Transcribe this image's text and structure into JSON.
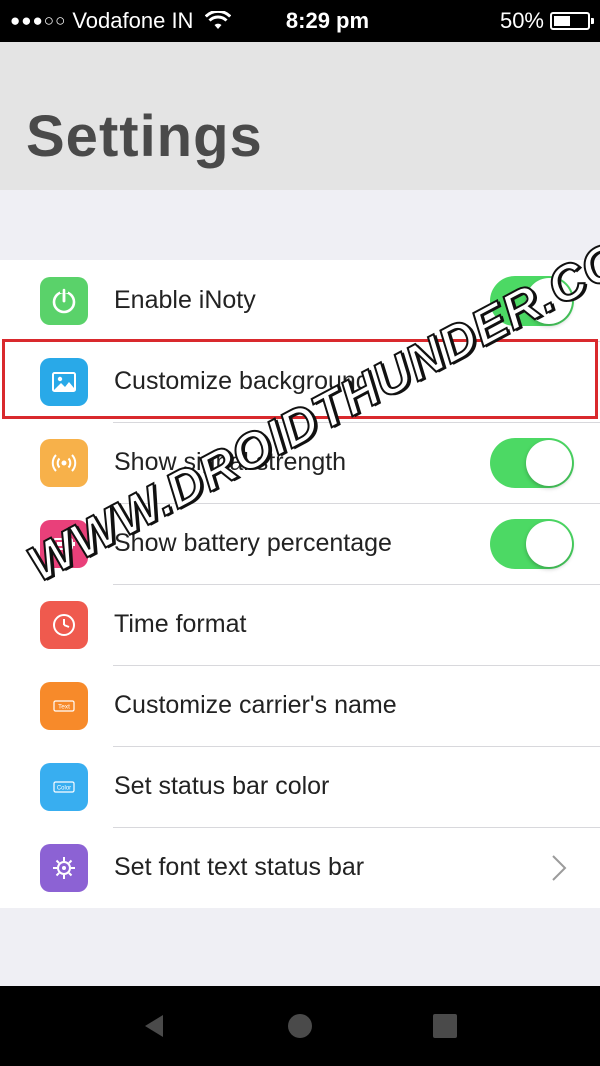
{
  "status_bar": {
    "carrier": "Vodafone IN",
    "time": "8:29 pm",
    "battery": "50%",
    "battery_level": 0.5,
    "signal_dots": "●●●○○"
  },
  "header": {
    "title": "Settings"
  },
  "settings": [
    {
      "label": "Enable iNoty",
      "icon": "power-icon",
      "color": "#5ad26a",
      "control": "toggle",
      "on": true
    },
    {
      "label": "Customize background",
      "icon": "image-icon",
      "color": "#29a9e8",
      "control": "none"
    },
    {
      "label": "Show signal strength",
      "icon": "signal-icon",
      "color": "#f7b14a",
      "control": "toggle",
      "on": true
    },
    {
      "label": "Show battery percentage",
      "icon": "battery-icon",
      "color": "#e9407a",
      "control": "toggle",
      "on": true
    },
    {
      "label": "Time format",
      "icon": "clock-icon",
      "color": "#ef5a4e",
      "control": "none"
    },
    {
      "label": "Customize carrier's name",
      "icon": "text-icon",
      "color": "#f78a2a",
      "control": "none",
      "icon_text": "Text"
    },
    {
      "label": "Set status bar color",
      "icon": "color-icon",
      "color": "#38aef0",
      "control": "none",
      "icon_text": "Color"
    },
    {
      "label": "Set font text status bar",
      "icon": "font-icon",
      "color": "#8c62d4",
      "control": "chevron"
    }
  ],
  "watermark": "WWW.DROIDTHUNDER.COM",
  "colors": {
    "toggle_on": "#4cd964",
    "highlight": "#d9292d"
  }
}
